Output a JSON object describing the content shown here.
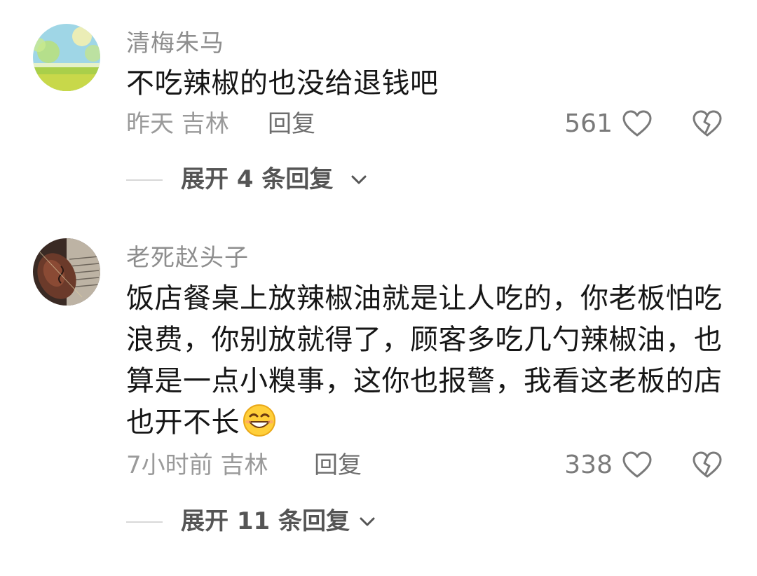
{
  "comments": [
    {
      "username": "清梅朱马",
      "content": "不吃辣椒的也没给退钱吧",
      "time_location": "昨天 吉林",
      "reply_label": "回复",
      "likes": "561",
      "expand_label": "展开 4 条回复",
      "avatar_icon": "landscape-avatar"
    },
    {
      "username": "老死赵头子",
      "content": "饭店餐桌上放辣椒油就是让人吃的，你老板怕吃浪费，你别放就得了，顾客多吃几勺辣椒油，也算是一点小糗事，这你也报警，我看这老板的店也开不长",
      "emoji": "grinning-face-emoji",
      "time_location": "7小时前 吉林",
      "reply_label": "回复",
      "likes": "338",
      "expand_label": "展开 11 条回复",
      "avatar_icon": "violin-avatar"
    }
  ],
  "colors": {
    "username": "#8e8e8e",
    "content": "#161616",
    "meta": "#9a9a9a",
    "reply": "#6d6d6d",
    "expand": "#555555",
    "divider": "#d8d8d8"
  }
}
